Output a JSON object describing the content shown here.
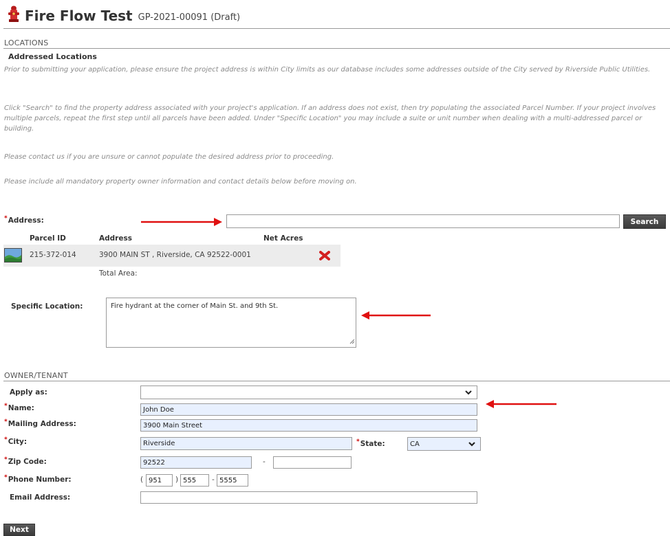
{
  "header": {
    "title": "Fire Flow Test",
    "record_id": "GP-2021-00091 (Draft)"
  },
  "locations": {
    "section_label": "LOCATIONS",
    "subheading": "Addressed Locations",
    "paragraphs": [
      "Prior to submitting your application, please ensure the project address is within City limits as our database includes some addresses outside of the City served by Riverside Public Utilities.",
      "Click \"Search\" to find the property address associated with your project's application. If an address does not exist, then try populating the associated Parcel Number. If your project involves multiple parcels, repeat the first step until all parcels have been added. Under \"Specific Location\" you may include a suite or unit number when dealing with a multi-addressed parcel or building.",
      "Please contact us if you are unsure or cannot populate the desired address prior to proceeding.",
      "Please include all mandatory property owner information and contact details below before moving on."
    ],
    "address_label": "Address:",
    "address_value": "",
    "search_label": "Search",
    "table": {
      "headers": [
        "Parcel ID",
        "Address",
        "Net Acres"
      ],
      "rows": [
        {
          "parcel_id": "215-372-014",
          "address": "3900 MAIN ST , Riverside, CA 92522-0001",
          "net_acres": ""
        }
      ],
      "total_label": "Total Area:"
    },
    "specific_location_label": "Specific Location:",
    "specific_location_value": "Fire hydrant at the corner of Main St. and 9th St."
  },
  "owner": {
    "section_label": "OWNER/TENANT",
    "apply_as_label": "Apply as:",
    "apply_as_value": "",
    "name_label": "Name:",
    "name_value": "John Doe",
    "mailing_label": "Mailing Address:",
    "mailing_value": "3900 Main Street",
    "city_label": "City:",
    "city_value": "Riverside",
    "state_label": "State:",
    "state_value": "CA",
    "zip_label": "Zip Code:",
    "zip_value": "92522",
    "zip_ext_value": "",
    "zip_sep": "-",
    "phone_label": "Phone Number:",
    "phone_area": "951",
    "phone_prefix": "555",
    "phone_line": "5555",
    "phone_open": "(",
    "phone_close": ")",
    "phone_dash": "-",
    "email_label": "Email Address:",
    "email_value": ""
  },
  "footer": {
    "next_label": "Next"
  },
  "colors": {
    "annotation_arrow": "#e01010",
    "filled_field": "#e8f0fe",
    "button_dark": "#3b3b3b"
  },
  "icons": [
    "fire-hydrant-icon",
    "parcel-map-icon",
    "remove-icon",
    "chevron-down-icon",
    "resize-grip-icon"
  ]
}
